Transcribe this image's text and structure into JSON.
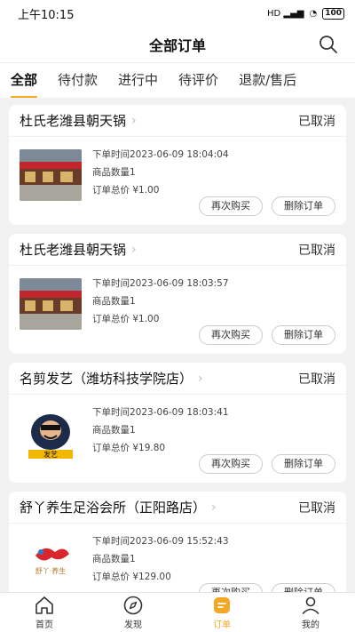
{
  "status_bar": {
    "time": "上午10:15",
    "signal": "HD",
    "battery": "100"
  },
  "header": {
    "title": "全部订单"
  },
  "tabs": [
    {
      "label": "全部",
      "active": true
    },
    {
      "label": "待付款"
    },
    {
      "label": "进行中"
    },
    {
      "label": "待评价"
    },
    {
      "label": "退款/售后"
    }
  ],
  "orders": [
    {
      "store": "杜氏老潍县朝天锅",
      "status": "已取消",
      "time": "下单时间2023-06-09 18:04:04",
      "qty": "商品数量1",
      "total": "订单总价 ¥1.00",
      "rebuy": "再次购买",
      "delete": "删除订单"
    },
    {
      "store": "杜氏老潍县朝天锅",
      "status": "已取消",
      "time": "下单时间2023-06-09 18:03:57",
      "qty": "商品数量1",
      "total": "订单总价 ¥1.00",
      "rebuy": "再次购买",
      "delete": "删除订单"
    },
    {
      "store": "名剪发艺（潍坊科技学院店）",
      "status": "已取消",
      "time": "下单时间2023-06-09 18:03:41",
      "qty": "商品数量1",
      "total": "订单总价 ¥19.80",
      "rebuy": "再次购买",
      "delete": "删除订单"
    },
    {
      "store": "舒丫养生足浴会所（正阳路店）",
      "status": "已取消",
      "time": "下单时间2023-06-09 15:52:43",
      "qty": "商品数量1",
      "total": "订单总价 ¥129.00",
      "rebuy": "再次购买",
      "delete": "删除订单"
    }
  ],
  "thumb_text": {
    "logo3": "发艺",
    "logo4": "舒丫·养生"
  },
  "bottom_nav": [
    {
      "label": "首页",
      "icon": "home-icon"
    },
    {
      "label": "发现",
      "icon": "compass-icon"
    },
    {
      "label": "订单",
      "icon": "order-icon",
      "active": true
    },
    {
      "label": "我的",
      "icon": "user-icon"
    }
  ],
  "colors": {
    "accent": "#f5a623",
    "background": "#f2f2f2"
  }
}
